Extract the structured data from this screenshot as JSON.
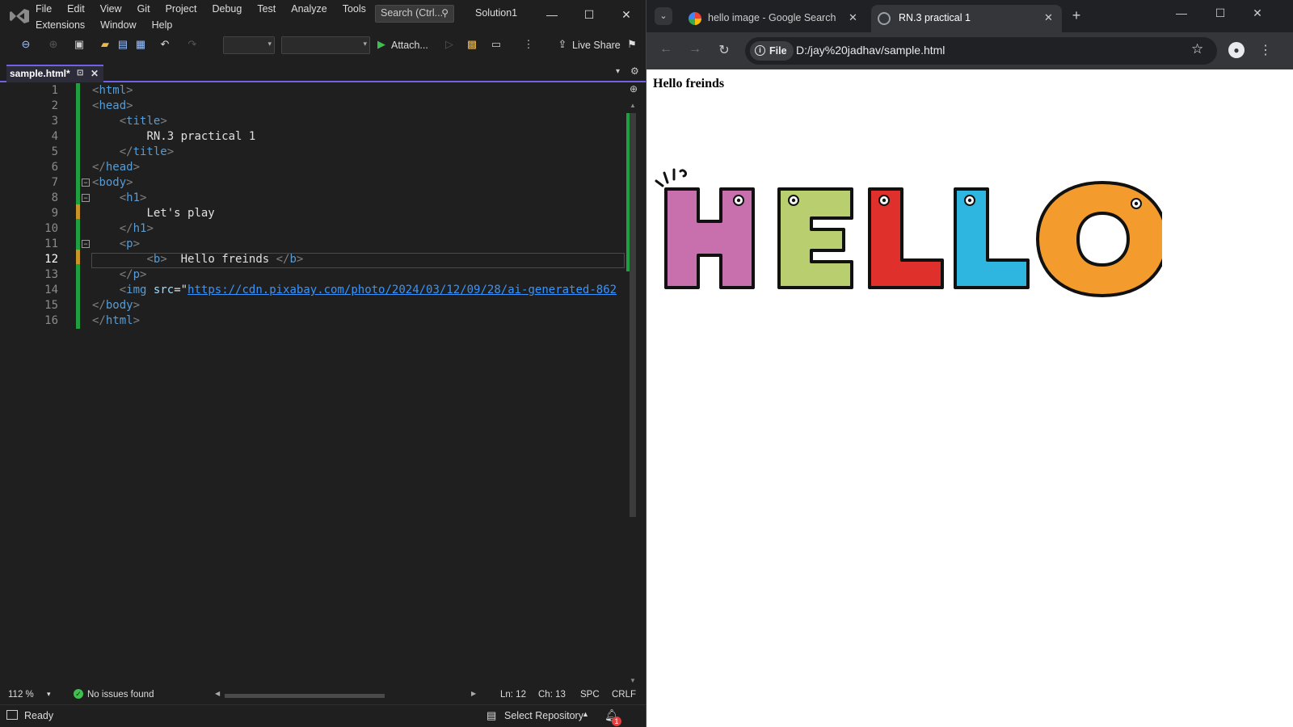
{
  "vs": {
    "menu_row1": [
      "File",
      "Edit",
      "View",
      "Git",
      "Project",
      "Debug",
      "Test",
      "Analyze",
      "Tools"
    ],
    "menu_row2": [
      "Extensions",
      "Window",
      "Help"
    ],
    "search_label": "Search (Ctrl...",
    "solution_name": "Solution1",
    "attach_label": "Attach...",
    "live_share_label": "Live Share",
    "tab_title": "sample.html*",
    "lines": [
      {
        "n": "1"
      },
      {
        "n": "2"
      },
      {
        "n": "3"
      },
      {
        "n": "4"
      },
      {
        "n": "5"
      },
      {
        "n": "6"
      },
      {
        "n": "7"
      },
      {
        "n": "8"
      },
      {
        "n": "9"
      },
      {
        "n": "10"
      },
      {
        "n": "11"
      },
      {
        "n": "12"
      },
      {
        "n": "13"
      },
      {
        "n": "14"
      },
      {
        "n": "15"
      },
      {
        "n": "16"
      }
    ],
    "code": {
      "l4_text": "RN.3 practical 1",
      "l9_text": "Let's play",
      "l12_text": " Hello freinds ",
      "l14_attr": "src",
      "l14_url": "https://cdn.pixabay.com/photo/2024/03/12/09/28/ai-generated-862"
    },
    "zoom": "112 %",
    "issues": "No issues found",
    "ln": "Ln: 12",
    "ch": "Ch: 13",
    "spc": "SPC",
    "crlf": "CRLF",
    "status_ready": "Ready",
    "select_repo": "Select Repository",
    "notif_count": "1"
  },
  "browser": {
    "tab1_title": "hello image - Google Search",
    "tab2_title": "RN.3 practical 1",
    "file_chip": "File",
    "url": "D:/jay%20jadhav/sample.html",
    "page_text": "Hello freinds",
    "hello_letters": [
      "H",
      "E",
      "L",
      "L",
      "O"
    ],
    "letter_colors": [
      "#c86fae",
      "#b9cf6f",
      "#e0302b",
      "#2fb6e0",
      "#f39c2d"
    ]
  }
}
